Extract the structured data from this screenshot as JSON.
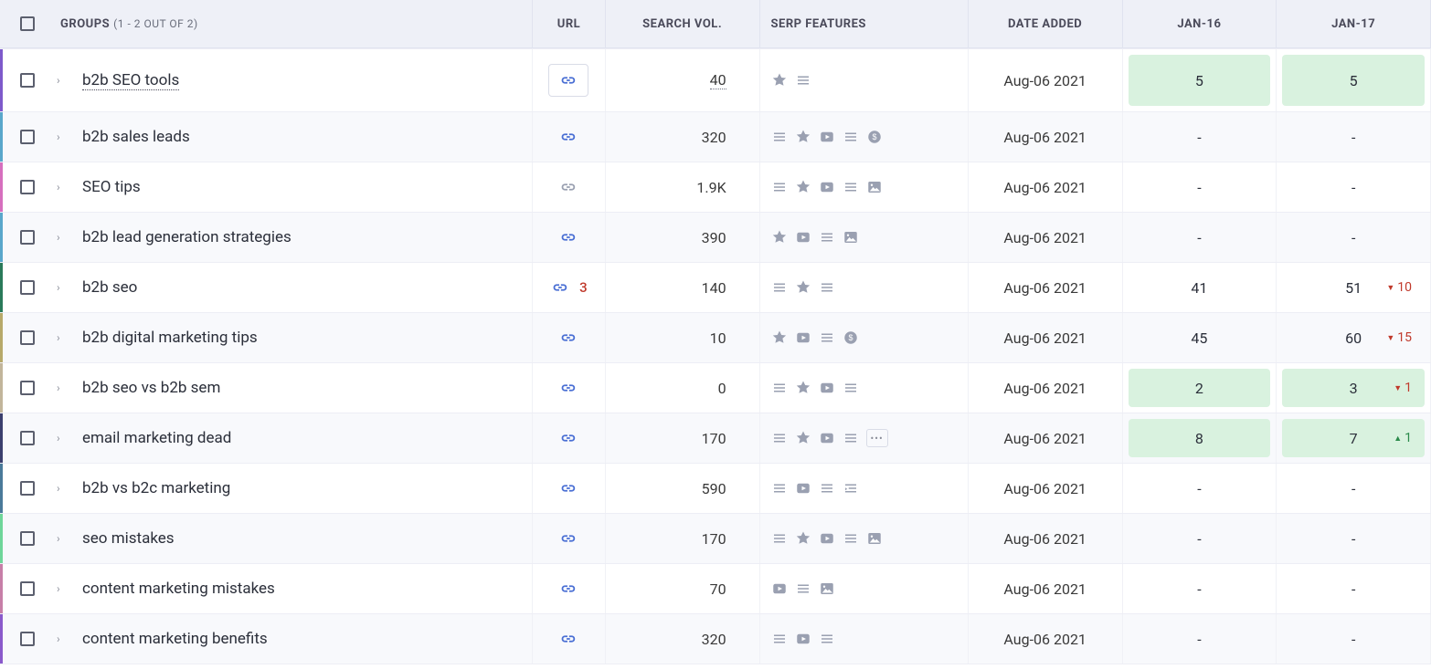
{
  "header": {
    "groups_label": "GROUPS",
    "groups_count": "(1 - 2 OUT OF 2)",
    "columns": {
      "url": "URL",
      "search_vol": "SEARCH VOL.",
      "serp": "SERP FEATURES",
      "date": "DATE ADDED",
      "rank1": "JAN-16",
      "rank2": "JAN-17"
    }
  },
  "rows": [
    {
      "keyword": "b2b SEO tools",
      "keyword_dotted": true,
      "color": "#7e5acb",
      "url_style": "boxed-blue",
      "search_vol": "40",
      "search_vol_dotted": true,
      "serp": [
        "star",
        "lines"
      ],
      "date": "Aug-06 2021",
      "rank1": {
        "value": "5",
        "green": true
      },
      "rank2": {
        "value": "5",
        "green": true
      }
    },
    {
      "keyword": "b2b sales leads",
      "color": "#5aa7cb",
      "url_style": "plain-blue",
      "search_vol": "320",
      "serp": [
        "lines",
        "star",
        "video",
        "lines",
        "dollar"
      ],
      "date": "Aug-06 2021",
      "rank1": {
        "value": "-"
      },
      "rank2": {
        "value": "-"
      }
    },
    {
      "keyword": "SEO tips",
      "color": "#d66fbe",
      "url_style": "plain-gray",
      "search_vol": "1.9K",
      "serp": [
        "lines",
        "star",
        "video",
        "lines",
        "image"
      ],
      "date": "Aug-06 2021",
      "rank1": {
        "value": "-"
      },
      "rank2": {
        "value": "-"
      }
    },
    {
      "keyword": "b2b lead generation strategies",
      "color": "#5aa7cb",
      "url_style": "plain-blue",
      "search_vol": "390",
      "serp": [
        "star",
        "video",
        "lines",
        "image"
      ],
      "date": "Aug-06 2021",
      "rank1": {
        "value": "-"
      },
      "rank2": {
        "value": "-"
      }
    },
    {
      "keyword": "b2b seo",
      "color": "#2a7a5a",
      "url_style": "plain-blue-badge",
      "url_badge": "3",
      "search_vol": "140",
      "serp": [
        "lines",
        "star",
        "lines"
      ],
      "date": "Aug-06 2021",
      "rank1": {
        "value": "41"
      },
      "rank2": {
        "value": "51",
        "delta": "10",
        "dir": "down"
      }
    },
    {
      "keyword": "b2b digital marketing tips",
      "color": "#b7a96a",
      "url_style": "plain-blue",
      "search_vol": "10",
      "serp": [
        "star",
        "video",
        "lines",
        "dollar"
      ],
      "date": "Aug-06 2021",
      "rank1": {
        "value": "45"
      },
      "rank2": {
        "value": "60",
        "delta": "15",
        "dir": "down"
      }
    },
    {
      "keyword": "b2b seo vs b2b sem",
      "color": "#c2b59b",
      "url_style": "plain-blue",
      "search_vol": "0",
      "serp": [
        "lines",
        "star",
        "video",
        "lines"
      ],
      "date": "Aug-06 2021",
      "rank1": {
        "value": "2",
        "green": true
      },
      "rank2": {
        "value": "3",
        "green": true,
        "delta": "1",
        "dir": "down"
      }
    },
    {
      "keyword": "email marketing dead",
      "color": "#3b3f6e",
      "url_style": "plain-blue",
      "search_vol": "170",
      "serp": [
        "lines",
        "star",
        "video",
        "lines",
        "more"
      ],
      "date": "Aug-06 2021",
      "rank1": {
        "value": "8",
        "green": true
      },
      "rank2": {
        "value": "7",
        "green": true,
        "delta": "1",
        "dir": "up"
      }
    },
    {
      "keyword": "b2b vs b2c marketing",
      "color": "#4a7a9a",
      "url_style": "plain-blue",
      "search_vol": "590",
      "serp": [
        "lines",
        "video",
        "lines",
        "indent"
      ],
      "date": "Aug-06 2021",
      "rank1": {
        "value": "-"
      },
      "rank2": {
        "value": "-"
      }
    },
    {
      "keyword": "seo mistakes",
      "color": "#6fd69a",
      "url_style": "plain-blue",
      "search_vol": "170",
      "serp": [
        "lines",
        "star",
        "video",
        "lines",
        "image"
      ],
      "date": "Aug-06 2021",
      "rank1": {
        "value": "-"
      },
      "rank2": {
        "value": "-"
      }
    },
    {
      "keyword": "content marketing mistakes",
      "color": "#c77fa8",
      "url_style": "plain-blue",
      "search_vol": "70",
      "serp": [
        "video",
        "lines",
        "image"
      ],
      "date": "Aug-06 2021",
      "rank1": {
        "value": "-"
      },
      "rank2": {
        "value": "-"
      }
    },
    {
      "keyword": "content marketing benefits",
      "color": "#8a5acb",
      "url_style": "plain-blue",
      "search_vol": "320",
      "serp": [
        "lines",
        "video",
        "lines"
      ],
      "date": "Aug-06 2021",
      "rank1": {
        "value": "-"
      },
      "rank2": {
        "value": "-"
      }
    }
  ]
}
